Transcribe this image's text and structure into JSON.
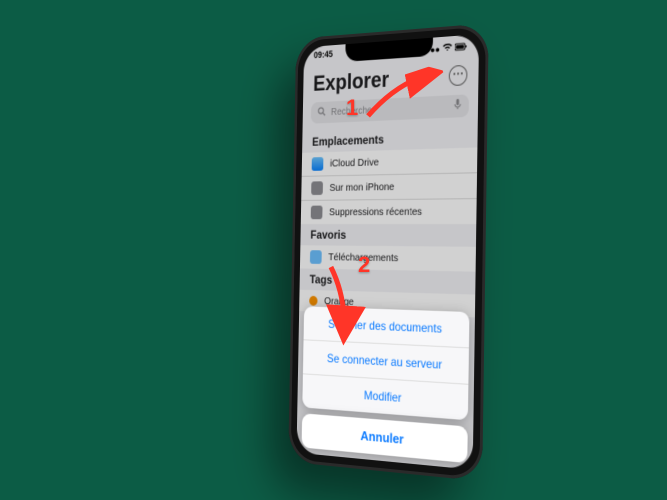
{
  "status": {
    "time": "09:45"
  },
  "title": "Explorer",
  "search_placeholder": "Rechercher",
  "sections": {
    "locations": {
      "header": "Emplacements",
      "items": [
        "iCloud Drive",
        "Sur mon iPhone",
        "Suppressions récentes"
      ]
    },
    "favorites": {
      "header": "Favoris",
      "items": [
        "Téléchargements"
      ]
    },
    "tags": {
      "header": "Tags",
      "items": [
        "Orange"
      ]
    }
  },
  "action_sheet": {
    "items": [
      "Scanner des documents",
      "Se connecter au serveur",
      "Modifier"
    ],
    "cancel": "Annuler"
  },
  "annotations": {
    "one": "1",
    "two": "2"
  }
}
